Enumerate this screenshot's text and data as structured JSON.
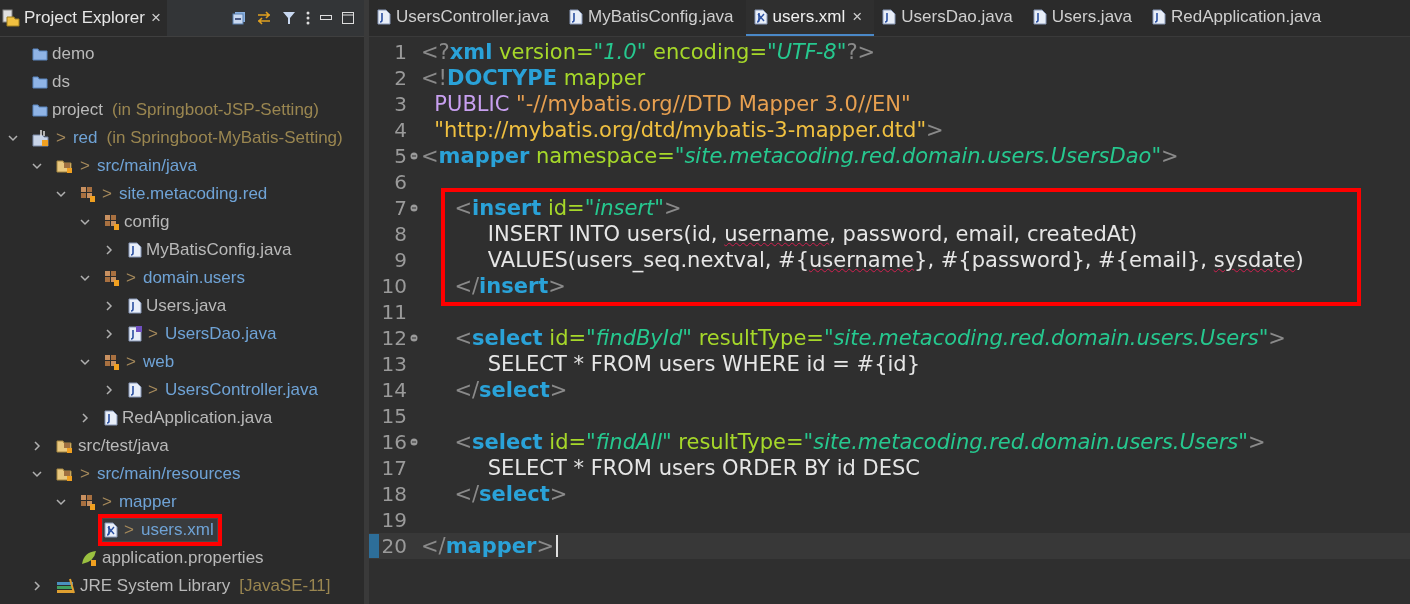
{
  "explorer": {
    "title": "Project Explorer",
    "close": "×",
    "tree": [
      {
        "label": "demo",
        "kind": "project"
      },
      {
        "label": "ds",
        "kind": "project"
      },
      {
        "label": "project",
        "suffix": "(in Springboot-JSP-Setting)",
        "kind": "project"
      },
      {
        "label": "red",
        "prefix": ">",
        "suffix": "(in Springboot-MyBatis-Setting)",
        "kind": "project-open",
        "expanded": true,
        "children": [
          {
            "label": "src/main/java",
            "prefix": ">",
            "kind": "source-folder",
            "expanded": true,
            "children": [
              {
                "label": "site.metacoding.red",
                "prefix": ">",
                "kind": "package",
                "expanded": true,
                "children": [
                  {
                    "label": "config",
                    "kind": "package",
                    "expanded": true,
                    "children": [
                      {
                        "label": "MyBatisConfig.java",
                        "kind": "java",
                        "expanded": false
                      }
                    ]
                  },
                  {
                    "label": "domain.users",
                    "prefix": ">",
                    "kind": "package",
                    "expanded": true,
                    "children": [
                      {
                        "label": "Users.java",
                        "kind": "java",
                        "expanded": false
                      },
                      {
                        "label": "UsersDao.java",
                        "prefix": ">",
                        "kind": "interface",
                        "expanded": false
                      }
                    ]
                  },
                  {
                    "label": "web",
                    "prefix": ">",
                    "kind": "package",
                    "expanded": true,
                    "children": [
                      {
                        "label": "UsersController.java",
                        "prefix": ">",
                        "kind": "java",
                        "expanded": false
                      }
                    ]
                  },
                  {
                    "label": "RedApplication.java",
                    "kind": "java",
                    "expanded": false
                  }
                ]
              }
            ]
          },
          {
            "label": "src/test/java",
            "kind": "source-folder",
            "expanded": false
          },
          {
            "label": "src/main/resources",
            "prefix": ">",
            "kind": "source-folder",
            "expanded": true,
            "children": [
              {
                "label": "mapper",
                "prefix": ">",
                "kind": "package",
                "expanded": true,
                "children": [
                  {
                    "label": "users.xml",
                    "prefix": ">",
                    "kind": "xml",
                    "selected": true,
                    "boxed": true
                  }
                ]
              },
              {
                "label": "application.properties",
                "kind": "properties"
              }
            ]
          },
          {
            "label": "JRE System Library",
            "suffix": "[JavaSE-11]",
            "kind": "library",
            "expanded": false
          }
        ]
      }
    ]
  },
  "tabs": [
    {
      "label": "UsersController.java",
      "kind": "java",
      "selected": false
    },
    {
      "label": "MyBatisConfig.java",
      "kind": "java",
      "selected": false
    },
    {
      "label": "users.xml",
      "kind": "xml",
      "selected": true,
      "close": "×"
    },
    {
      "label": "UsersDao.java",
      "kind": "java",
      "selected": false
    },
    {
      "label": "Users.java",
      "kind": "java",
      "selected": false
    },
    {
      "label": "RedApplication.java",
      "kind": "java",
      "selected": false
    }
  ],
  "editor": {
    "lines": [
      {
        "number": "1",
        "tokens": [
          {
            "kind": "punct",
            "text": "<?"
          },
          {
            "kind": "tag",
            "text": "xml"
          },
          {
            "kind": "attr",
            "text": " version="
          },
          {
            "kind": "value",
            "text": "\"1.0\""
          },
          {
            "kind": "attr",
            "text": " encoding="
          },
          {
            "kind": "value",
            "text": "\"UTF-8\""
          },
          {
            "kind": "punct",
            "text": "?>"
          }
        ]
      },
      {
        "number": "2",
        "tokens": [
          {
            "kind": "punct",
            "text": "<!"
          },
          {
            "kind": "tag",
            "text": "DOCTYPE"
          },
          {
            "kind": "attr",
            "text": " mapper"
          }
        ]
      },
      {
        "number": "3",
        "tokens": [
          {
            "kind": "keyword",
            "text": "  PUBLIC"
          },
          {
            "kind": "string",
            "text": " \"-//mybatis.org//DTD Mapper 3.0//EN\""
          }
        ]
      },
      {
        "number": "4",
        "tokens": [
          {
            "kind": "uri",
            "text": "  \"http://mybatis.org/dtd/mybatis-3-mapper.dtd\""
          },
          {
            "kind": "punct",
            "text": ">"
          }
        ]
      },
      {
        "number": "5",
        "fold": true,
        "tokens": [
          {
            "kind": "punct",
            "text": "<"
          },
          {
            "kind": "tag",
            "text": "mapper"
          },
          {
            "kind": "attr",
            "text": " namespace="
          },
          {
            "kind": "value",
            "text": "\"site.metacoding.red.domain.users.UsersDao\""
          },
          {
            "kind": "punct",
            "text": ">"
          }
        ]
      },
      {
        "number": "6"
      },
      {
        "number": "7",
        "fold": true,
        "boxed": true,
        "tokens": [
          {
            "kind": "punct",
            "text": "     <"
          },
          {
            "kind": "tag",
            "text": "insert"
          },
          {
            "kind": "attr",
            "text": " id="
          },
          {
            "kind": "value",
            "text": "\"insert\""
          },
          {
            "kind": "punct",
            "text": ">"
          }
        ]
      },
      {
        "number": "8",
        "boxed": true,
        "tokens": [
          {
            "kind": "text",
            "text": "          INSERT INTO users(id, "
          },
          {
            "kind": "misspelled",
            "text": "username"
          },
          {
            "kind": "text",
            "text": ", password, email, createdAt)"
          }
        ]
      },
      {
        "number": "9",
        "boxed": true,
        "tokens": [
          {
            "kind": "text",
            "text": "          VALUES(users_seq.nextval, #{"
          },
          {
            "kind": "misspelled",
            "text": "username"
          },
          {
            "kind": "text",
            "text": "}, #{password}, #{email}, "
          },
          {
            "kind": "misspelled",
            "text": "sysdate"
          },
          {
            "kind": "text",
            "text": ")"
          }
        ]
      },
      {
        "number": "10",
        "boxed": true,
        "tokens": [
          {
            "kind": "punct",
            "text": "     </"
          },
          {
            "kind": "tag",
            "text": "insert"
          },
          {
            "kind": "punct",
            "text": ">"
          }
        ]
      },
      {
        "number": "11"
      },
      {
        "number": "12",
        "fold": true,
        "tokens": [
          {
            "kind": "punct",
            "text": "     <"
          },
          {
            "kind": "tag",
            "text": "select"
          },
          {
            "kind": "attr",
            "text": " id="
          },
          {
            "kind": "value",
            "text": "\"findById\""
          },
          {
            "kind": "attr",
            "text": " resultType="
          },
          {
            "kind": "value",
            "text": "\"site.metacoding.red.domain.users.Users\""
          },
          {
            "kind": "punct",
            "text": ">"
          }
        ]
      },
      {
        "number": "13",
        "tokens": [
          {
            "kind": "text",
            "text": "          SELECT * FROM users WHERE id = #{id}"
          }
        ]
      },
      {
        "number": "14",
        "tokens": [
          {
            "kind": "punct",
            "text": "     </"
          },
          {
            "kind": "tag",
            "text": "select"
          },
          {
            "kind": "punct",
            "text": ">"
          }
        ]
      },
      {
        "number": "15"
      },
      {
        "number": "16",
        "fold": true,
        "tokens": [
          {
            "kind": "punct",
            "text": "     <"
          },
          {
            "kind": "tag",
            "text": "select"
          },
          {
            "kind": "attr",
            "text": " id="
          },
          {
            "kind": "value",
            "text": "\"findAll\""
          },
          {
            "kind": "attr",
            "text": " resultType="
          },
          {
            "kind": "value",
            "text": "\"site.metacoding.red.domain.users.Users\""
          },
          {
            "kind": "punct",
            "text": ">"
          }
        ]
      },
      {
        "number": "17",
        "tokens": [
          {
            "kind": "text",
            "text": "          SELECT * FROM users ORDER BY id DESC"
          }
        ]
      },
      {
        "number": "18",
        "tokens": [
          {
            "kind": "punct",
            "text": "     </"
          },
          {
            "kind": "tag",
            "text": "select"
          },
          {
            "kind": "punct",
            "text": ">"
          }
        ]
      },
      {
        "number": "19"
      },
      {
        "number": "20",
        "current": true,
        "tokens": [
          {
            "kind": "punct",
            "text": "</"
          },
          {
            "kind": "tag",
            "text": "mapper"
          },
          {
            "kind": "punct",
            "text": ">"
          }
        ]
      }
    ]
  }
}
